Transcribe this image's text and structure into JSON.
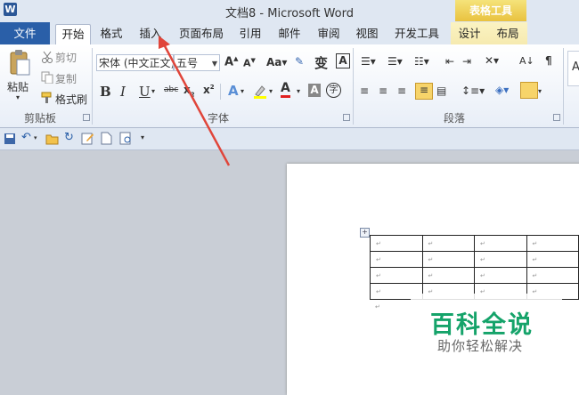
{
  "window": {
    "title": "文档8 - Microsoft Word",
    "app_icon": "W"
  },
  "context_group": "表格工具",
  "tabs": [
    {
      "label": "文件"
    },
    {
      "label": "开始"
    },
    {
      "label": "格式"
    },
    {
      "label": "插入"
    },
    {
      "label": "页面布局"
    },
    {
      "label": "引用"
    },
    {
      "label": "邮件"
    },
    {
      "label": "审阅"
    },
    {
      "label": "视图"
    },
    {
      "label": "开发工具"
    },
    {
      "label": "设计"
    },
    {
      "label": "布局"
    }
  ],
  "clipboard": {
    "paste": "粘贴",
    "cut": "剪切",
    "copy": "复制",
    "format_painter": "格式刷",
    "label": "剪贴板"
  },
  "font": {
    "font_name": "宋体 (中文正文)",
    "font_size": "五号",
    "label": "字体"
  },
  "paragraph": {
    "label": "段落"
  },
  "styles_preview": "A",
  "table": {
    "rows": [
      [
        "↵",
        "↵",
        "↵",
        "↵"
      ],
      [
        "↵",
        "↵",
        "↵",
        "↵"
      ],
      [
        "↵",
        "↵",
        "↵",
        "↵"
      ],
      [
        "↵",
        "↵",
        "↵",
        "↵"
      ]
    ],
    "after_mark": "↵"
  },
  "watermark": {
    "title": "百科全说",
    "subtitle": "助你轻松解决"
  },
  "colors": {
    "file_tab": "#2a5fa8",
    "context": "#e9c23f",
    "annotation_arrow": "#e0453a",
    "watermark": "#15a36a"
  }
}
